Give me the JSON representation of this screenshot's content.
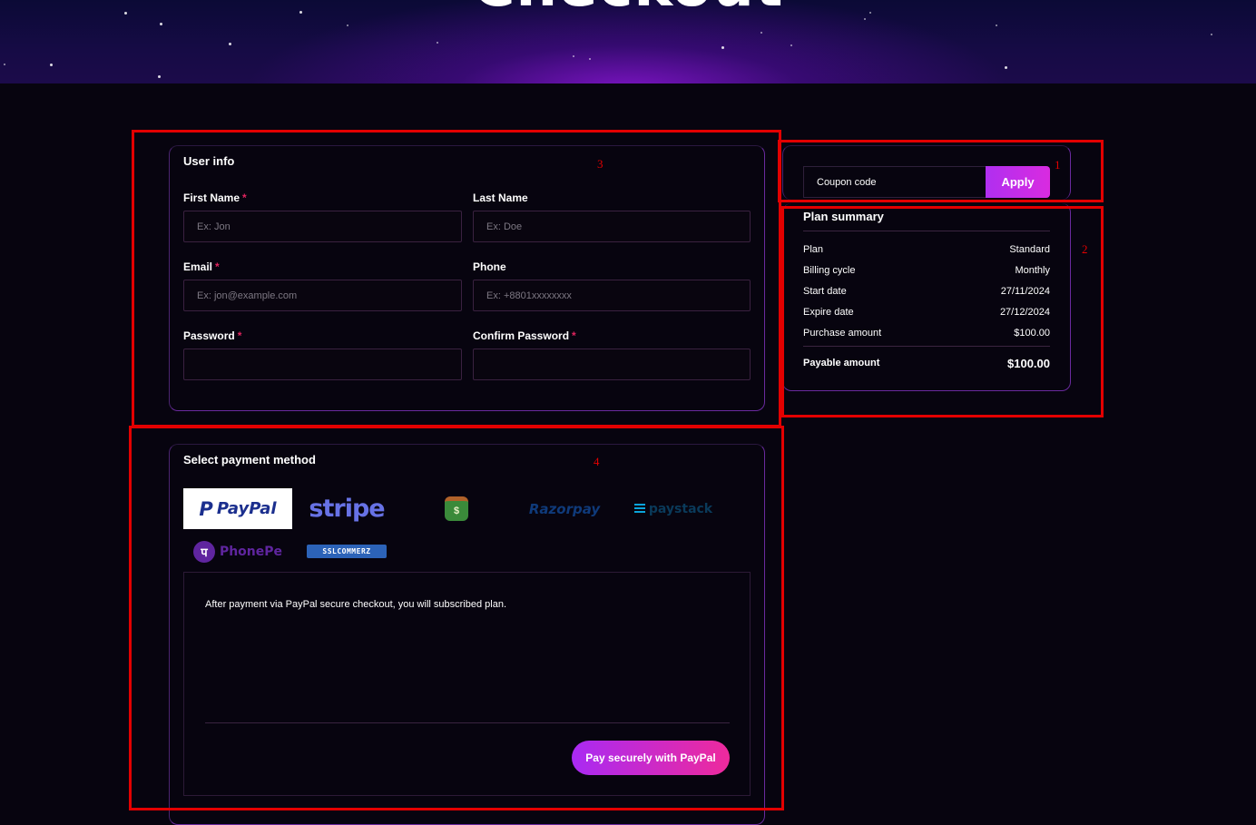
{
  "hero": {
    "title": "Checkout"
  },
  "user_info": {
    "title": "User info",
    "first_name": {
      "label": "First Name",
      "required": "*",
      "placeholder": "Ex: Jon"
    },
    "last_name": {
      "label": "Last Name",
      "placeholder": "Ex: Doe"
    },
    "email": {
      "label": "Email",
      "required": "*",
      "placeholder": "Ex: jon@example.com"
    },
    "phone": {
      "label": "Phone",
      "placeholder": "Ex: +8801xxxxxxxx"
    },
    "password": {
      "label": "Password",
      "required": "*",
      "placeholder": ""
    },
    "confirm_password": {
      "label": "Confirm Password",
      "required": "*",
      "placeholder": ""
    }
  },
  "coupon": {
    "placeholder": "Coupon code",
    "apply_label": "Apply"
  },
  "plan_summary": {
    "title": "Plan summary",
    "rows": [
      {
        "key": "Plan",
        "value": "Standard"
      },
      {
        "key": "Billing cycle",
        "value": "Monthly"
      },
      {
        "key": "Start date",
        "value": "27/11/2024"
      },
      {
        "key": "Expire date",
        "value": "27/12/2024"
      },
      {
        "key": "Purchase amount",
        "value": "$100.00"
      }
    ],
    "payable": {
      "key": "Payable amount",
      "value": "$100.00"
    }
  },
  "payment": {
    "title": "Select payment method",
    "methods": [
      {
        "name": "PayPal",
        "label": "PayPal",
        "selected": true
      },
      {
        "name": "Stripe",
        "label": "stripe"
      },
      {
        "name": "Cash",
        "label": "$",
        "icon": "money-bag-icon"
      },
      {
        "name": "Razorpay",
        "label": "Razorpay"
      },
      {
        "name": "Paystack",
        "label": "paystack"
      },
      {
        "name": "PhonePe",
        "label": "PhonePe"
      },
      {
        "name": "SSLCommerz",
        "label": "SSLCOMMERZ"
      }
    ],
    "note": "After payment via PayPal secure checkout, you will subscribed plan.",
    "pay_button": "Pay securely with PayPal"
  },
  "annotations": [
    "1",
    "2",
    "3",
    "4"
  ],
  "colors": {
    "accent": "#b02ff0",
    "accent2": "#ee2a9c",
    "background": "#07040f",
    "annotation": "#e30000"
  }
}
